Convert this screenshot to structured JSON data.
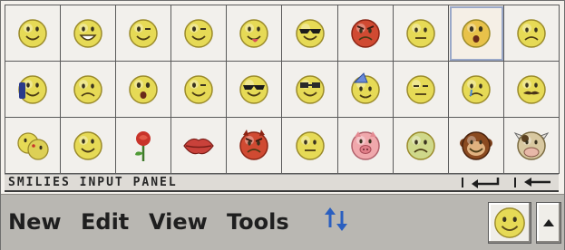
{
  "panel": {
    "title": "SMILIES INPUT PANEL",
    "enter_icon": "enter-arrow-icon",
    "backspace_icon": "backspace-arrow-icon",
    "selected_index": 8
  },
  "smilies": [
    {
      "icon": "happy-smiley-icon"
    },
    {
      "icon": "grinning-smiley-icon"
    },
    {
      "icon": "wink-smiley-icon"
    },
    {
      "icon": "grin-wink-smiley-icon"
    },
    {
      "icon": "tongue-out-smiley-icon"
    },
    {
      "icon": "sunglasses-smiley-icon"
    },
    {
      "icon": "angry-red-smiley-icon"
    },
    {
      "icon": "confused-smiley-icon"
    },
    {
      "icon": "surprised-smiley-icon"
    },
    {
      "icon": "sad-smiley-icon"
    },
    {
      "icon": "phone-smiley-icon"
    },
    {
      "icon": "worried-smiley-icon"
    },
    {
      "icon": "shocked-smiley-icon"
    },
    {
      "icon": "smirk-smiley-icon"
    },
    {
      "icon": "cool-smiley-icon"
    },
    {
      "icon": "nerd-glasses-smiley-icon"
    },
    {
      "icon": "party-hat-smiley-icon"
    },
    {
      "icon": "sleepy-smiley-icon"
    },
    {
      "icon": "crying-smiley-icon"
    },
    {
      "icon": "mustache-smiley-icon"
    },
    {
      "icon": "kissing-couple-smiley-icon"
    },
    {
      "icon": "blush-smiley-icon"
    },
    {
      "icon": "rose-icon"
    },
    {
      "icon": "lips-icon"
    },
    {
      "icon": "devil-smiley-icon"
    },
    {
      "icon": "neutral-smiley-icon"
    },
    {
      "icon": "pig-icon"
    },
    {
      "icon": "sick-smiley-icon"
    },
    {
      "icon": "monkey-icon"
    },
    {
      "icon": "cow-icon"
    }
  ],
  "menu": {
    "new_label": "New",
    "edit_label": "Edit",
    "view_label": "View",
    "tools_label": "Tools",
    "sort_icon": "sort-arrows-icon",
    "smiley_button_icon": "smiley-button-icon",
    "scroll_icon": "scroll-up-icon"
  },
  "colors": {
    "smiley_yellow": "#e8dc5a",
    "smiley_outline": "#9a8a2a",
    "angry_red": "#d04a32",
    "arrow_blue": "#2a5fc0",
    "menubar_bg": "#b9b7b2"
  }
}
